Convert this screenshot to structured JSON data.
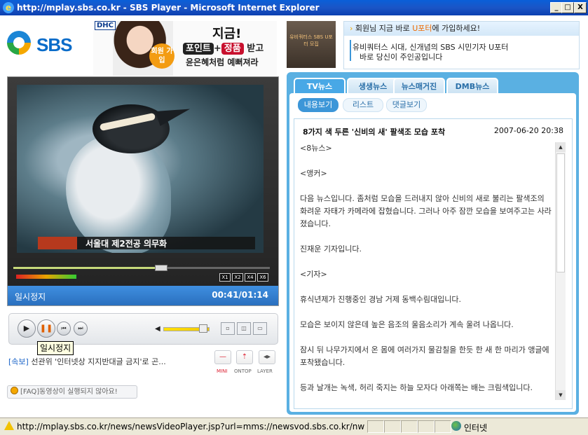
{
  "window": {
    "title": "http://mplay.sbs.co.kr - SBS Player - Microsoft Internet Explorer",
    "minimize_label": "_",
    "maximize_label": "□",
    "close_label": "X"
  },
  "header": {
    "logo_text": "SBS",
    "banner": {
      "brand": "DHC",
      "headline": "지금!",
      "offer_a": "포인트",
      "plus": "+",
      "offer_b": "정품",
      "offer_suffix": "받고",
      "tagline": "윤은혜처럼 예뻐져라",
      "badge": "회원 가입"
    }
  },
  "player": {
    "video_caption": "서울대 제2전공 의무화",
    "speed_buttons": [
      "X1",
      "X2",
      "X4",
      "X6"
    ],
    "progress": 0.57,
    "status": "일시정지",
    "time": "00:41/01:14",
    "volume": 0.88,
    "tooltip": "일시정지",
    "buttons": {
      "play": "▶",
      "pause": "❚❚",
      "prev": "⏮",
      "next": "⏭"
    }
  },
  "ticker": {
    "tag": "[속보]",
    "text": " 선관위 '인터넷상 지지반대글 금지'로 곤..."
  },
  "view_modes": [
    {
      "label": "MINI",
      "icon": "—"
    },
    {
      "label": "ONTOP",
      "icon": "⇡"
    },
    {
      "label": "LAYER",
      "icon": "◂▸"
    }
  ],
  "faq": "[FAQ]동영상이 실행되지 않아요!",
  "promo": {
    "image_text": "유비쿼터스 SBS U포터 모집",
    "head_user": "회원",
    "head_mid": "님 지금 바로 ",
    "head_link": "U포터",
    "head_suffix": "에 가입하세요!",
    "line1": "유비쿼터스 시대, 신개념의 SBS 시민기자 U포터",
    "line2": "바로 당신이 주인공입니다"
  },
  "news": {
    "tabs": [
      "TV뉴스",
      "생생뉴스",
      "뉴스매거진",
      "DMB뉴스"
    ],
    "subtabs": [
      "내용보기",
      "리스트",
      "댓글보기"
    ],
    "article": {
      "title": "8가지 색 두른 '신비의 새' 팔색조 모습 포착",
      "date": "2007-06-20 20:38",
      "paragraphs": [
        "<8뉴스>",
        "<앵커>",
        "다음 뉴스입니다. 좀처럼 모습을 드러내지 않아 신비의 새로 불리는 팔색조의 화려운 자태가 카메라에 잡혔습니다. 그러나 아주 잠깐 모습을 보여주고는 사라졌습니다.",
        "진재운 기자입니다.",
        "<기자>",
        "휴식년제가 진행중인 경남 거제 동백수림대입니다.",
        "모습은 보이지 않은데 높은 음조의 울음소리가 계속 울려 나옵니다.",
        "잠시 뒤 나무가지에서 온 몸에 여러가지 물감칠을 한듯 한 새 한 마리가 앵글에 포착됐습니다.",
        "등과 날개는 녹색, 허리 죽지는 하늘 모자다 아래쪽는 배는 크림색입니다."
      ]
    }
  },
  "statusbar": {
    "url": "http://mplay.sbs.co.kr/news/newsVideoPlayer.jsp?url=mms://newsvod.sbs.co.kr/nw",
    "zone": "인터넷"
  }
}
